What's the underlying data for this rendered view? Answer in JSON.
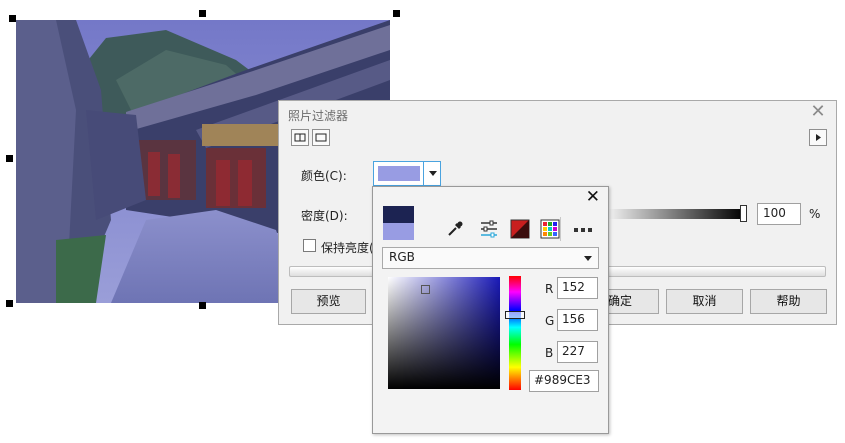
{
  "dialog": {
    "title": "照片过滤器",
    "color_label": "颜色(C):",
    "density_label": "密度(D):",
    "density_value": 100,
    "density_unit": "%",
    "keep_brightness_label": "保持亮度(L)",
    "keep_brightness_checked": false,
    "buttons": {
      "preview": "预览",
      "ok": "确定",
      "cancel": "取消",
      "help": "帮助"
    }
  },
  "picker": {
    "model": "RGB",
    "r_label": "R",
    "g_label": "G",
    "b_label": "B",
    "r": "152",
    "g": "156",
    "b": "227",
    "hex": "#989CE3",
    "new_color": "#1c2352",
    "old_color": "#989CE3",
    "tools": [
      "eyedropper-icon",
      "mixer-sliders-icon",
      "color-harmony-icon",
      "palette-grid-icon",
      "more-icon"
    ]
  }
}
